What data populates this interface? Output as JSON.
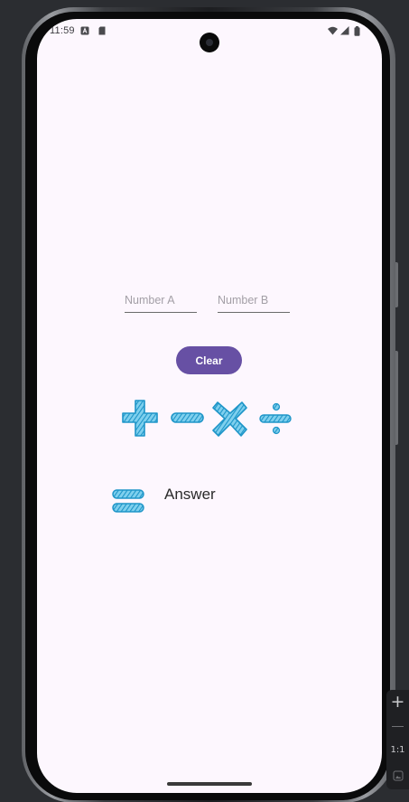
{
  "status_bar": {
    "time": "11:59",
    "left_icons": [
      "a-icon",
      "sd-card-icon"
    ],
    "right_icons": [
      "wifi-icon",
      "signal-icon",
      "battery-icon"
    ]
  },
  "inputs": {
    "number_a_placeholder": "Number A",
    "number_b_placeholder": "Number B"
  },
  "buttons": {
    "clear_label": "Clear"
  },
  "operations": [
    {
      "name": "plus",
      "icon": "plus-icon"
    },
    {
      "name": "minus",
      "icon": "minus-icon"
    },
    {
      "name": "multiply",
      "icon": "multiply-icon"
    },
    {
      "name": "divide",
      "icon": "divide-icon"
    }
  ],
  "result": {
    "equals_icon": "equals-icon",
    "answer_label": "Answer"
  },
  "emulator_toolbar": {
    "zoom_in": "+",
    "zoom_ratio": "1:1"
  },
  "colors": {
    "screen_background": "#fdf7fe",
    "accent": "#6750a4",
    "operator_blue": "#2aa6d6",
    "emulator_background": "#2b2d31"
  }
}
